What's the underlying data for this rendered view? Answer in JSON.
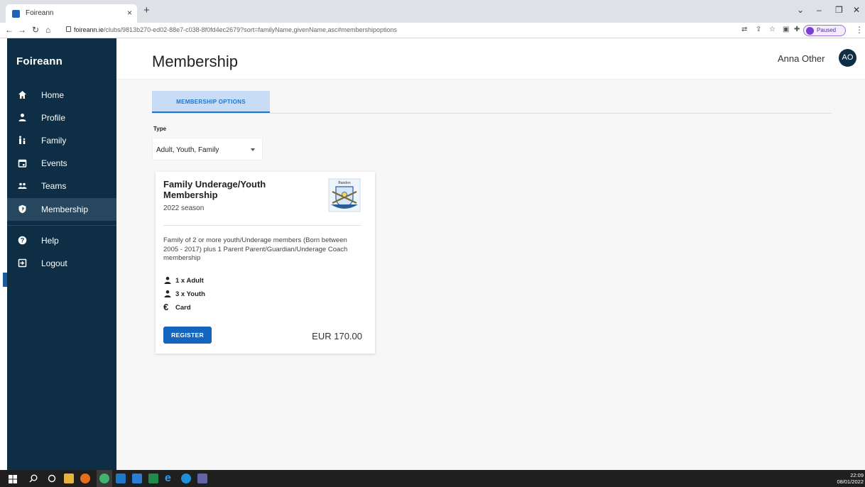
{
  "browser": {
    "tab_title": "Foireann",
    "tab_close": "×",
    "new_tab": "+",
    "url_host": "foireann.ie",
    "url_path": "/clubs/9813b270-ed02-88e7-c038-8f0fd4ec2679?sort=familyName,givenName,asc#membershipoptions",
    "profile_status": "Paused"
  },
  "sidebar": {
    "brand": "Foireann",
    "items": [
      {
        "label": "Home",
        "icon": "home-icon"
      },
      {
        "label": "Profile",
        "icon": "person-icon"
      },
      {
        "label": "Family",
        "icon": "family-icon"
      },
      {
        "label": "Events",
        "icon": "calendar-icon"
      },
      {
        "label": "Teams",
        "icon": "group-icon"
      },
      {
        "label": "Membership",
        "icon": "shield-icon",
        "active": true
      },
      {
        "label": "Help",
        "icon": "help-icon"
      },
      {
        "label": "Logout",
        "icon": "logout-icon"
      }
    ]
  },
  "header": {
    "title": "Membership",
    "user_name": "Anna Other",
    "avatar_initials": "AO"
  },
  "tabs": {
    "membership_options": "MEMBERSHIP OPTIONS"
  },
  "filter": {
    "type_label": "Type",
    "type_value": "Adult, Youth, Family"
  },
  "card": {
    "title": "Family Underage/Youth Membership",
    "season": "2022 season",
    "crest_label": "Bandon",
    "description": "Family of 2 or more youth/Underage members (Born between 2005 - 2017) plus 1 Parent Parent/Guardian/Underage Coach membership",
    "adult": "1 x Adult",
    "youth": "3 x Youth",
    "payment": "Card",
    "currency_symbol": "€",
    "register_label": "REGISTER",
    "price": "EUR 170.00"
  },
  "taskbar": {
    "time": "22:09",
    "date": "08/01/2022"
  },
  "colors": {
    "sidebar_bg": "#0d2e44",
    "sidebar_active": "#27475e",
    "accent": "#1976d2",
    "button": "#1565c0",
    "tab_bg": "#c9dcf5"
  }
}
